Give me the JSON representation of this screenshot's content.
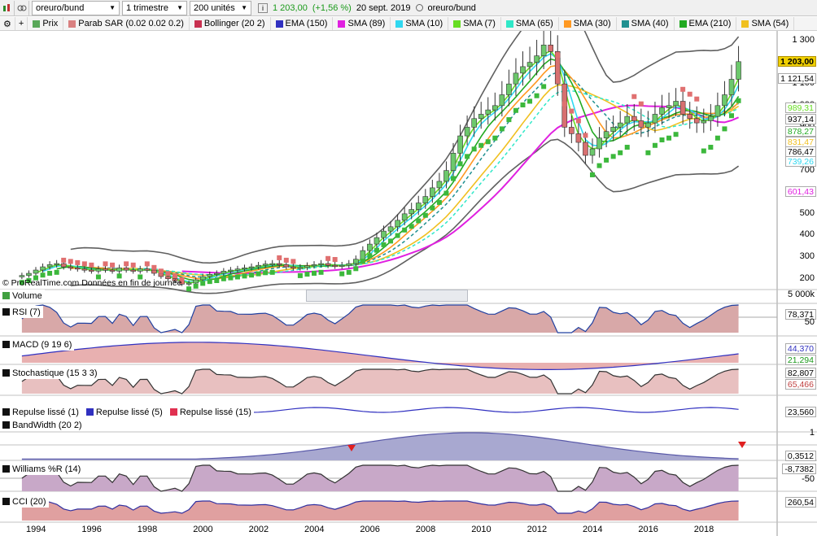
{
  "toolbar": {
    "symbol": "oreuro/bund",
    "period": "1 trimestre",
    "units": "200 unités",
    "last": "1 203,00",
    "change": "(+1,56 %)",
    "date": "20 sept. 2019",
    "instrument": "oreuro/bund"
  },
  "legend": [
    {
      "label": "Prix",
      "color": "#5aa85a"
    },
    {
      "label": "Parab SAR (0.02 0.02 0.2)",
      "color": "#d98080"
    },
    {
      "label": "Bollinger (20 2)",
      "color": "#c83050"
    },
    {
      "label": "EMA (150)",
      "color": "#3030c0"
    },
    {
      "label": "SMA (89)",
      "color": "#e020e0"
    },
    {
      "label": "SMA (10)",
      "color": "#30d8f0"
    },
    {
      "label": "SMA (7)",
      "color": "#66dd22"
    },
    {
      "label": "SMA (65)",
      "color": "#30e8c8"
    },
    {
      "label": "SMA (30)",
      "color": "#ff9922"
    },
    {
      "label": "SMA (40)",
      "color": "#209090"
    },
    {
      "label": "EMA (210)",
      "color": "#22aa22"
    },
    {
      "label": "SMA (54)",
      "color": "#f0c020"
    }
  ],
  "attribution": "© ProRealTime.com  Données en fin de journée",
  "price_axis": [
    "1 300",
    "1 200",
    "1 100",
    "1 000",
    "900",
    "800",
    "700",
    "600",
    "500",
    "400",
    "300",
    "200"
  ],
  "price_tags": [
    {
      "value": "1 203,00",
      "color": "#f0d000",
      "fill": true
    },
    {
      "value": "1 121,54",
      "color": "#000000"
    },
    {
      "value": "989,31",
      "color": "#66dd22"
    },
    {
      "value": "937,14",
      "color": "#000000"
    },
    {
      "value": "878,27",
      "color": "#22aa22"
    },
    {
      "value": "831,47",
      "color": "#f0c020"
    },
    {
      "value": "786,47",
      "color": "#000000"
    },
    {
      "value": "739,26",
      "color": "#30d8f0"
    },
    {
      "value": "601,43",
      "color": "#e020e0"
    }
  ],
  "panels": {
    "volume": {
      "label": "Volume",
      "axis": "5 000k"
    },
    "rsi": {
      "label": "RSI (7)",
      "value": "78,371",
      "axis": "50"
    },
    "macd": {
      "label": "MACD (9 19 6)",
      "value1": "44,370",
      "value2": "21,294"
    },
    "stoch": {
      "label": "Stochastique (15 3 3)",
      "value1": "82,807",
      "value2": "65,466"
    },
    "repulse": {
      "l1": "Repulse lissé (1)",
      "l2": "Repulse lissé (5)",
      "l3": "Repulse lissé (15)",
      "value": "23,560"
    },
    "bandwidth": {
      "label": "BandWidth (20 2)",
      "axis": "1",
      "value": "0,3512"
    },
    "williams": {
      "label": "Williams %R (14)",
      "value": "-8,7382",
      "axis": "-50"
    },
    "cci": {
      "label": "CCI (20)",
      "value": "260,54"
    }
  },
  "years": [
    "1994",
    "1996",
    "1998",
    "2000",
    "2002",
    "2004",
    "2006",
    "2008",
    "2010",
    "2012",
    "2014",
    "2016",
    "2018"
  ],
  "chart_data": {
    "type": "line",
    "title": "oreuro/bund",
    "x_start": 1993.5,
    "x_step": 0.25,
    "price_ylim": [
      180,
      1330
    ],
    "close": [
      215,
      225,
      240,
      255,
      265,
      270,
      255,
      250,
      245,
      240,
      235,
      245,
      240,
      235,
      250,
      240,
      235,
      245,
      240,
      225,
      210,
      200,
      190,
      175,
      180,
      195,
      210,
      220,
      225,
      235,
      240,
      245,
      250,
      255,
      262,
      268,
      270,
      265,
      255,
      250,
      252,
      260,
      265,
      270,
      262,
      258,
      262,
      270,
      290,
      330,
      360,
      390,
      420,
      440,
      470,
      500,
      520,
      550,
      580,
      620,
      650,
      700,
      780,
      860,
      900,
      940,
      960,
      980,
      1000,
      1050,
      1100,
      1150,
      1180,
      1200,
      1230,
      1280,
      1250,
      1100,
      900,
      870,
      830,
      770,
      800,
      850,
      880,
      900,
      920,
      950,
      930,
      900,
      920,
      960,
      990,
      1000,
      1020,
      960,
      940,
      920,
      930,
      950,
      1000,
      1050,
      1121.54,
      1203
    ],
    "sma10": [],
    "panel_names": [
      "RSI (7)",
      "MACD (9 19 6)",
      "Stochastique (15 3 3)",
      "Repulse lissé (1)",
      "BandWidth (20 2)",
      "Williams %R (14)",
      "CCI (20)"
    ],
    "last_values": {
      "rsi": 78.371,
      "macd": 44.37,
      "macd_signal": 21.294,
      "stoch_k": 82.807,
      "stoch_d": 65.466,
      "repulse": 23.56,
      "bandwidth": 0.3512,
      "williams": -8.7382,
      "cci": 260.54
    }
  }
}
